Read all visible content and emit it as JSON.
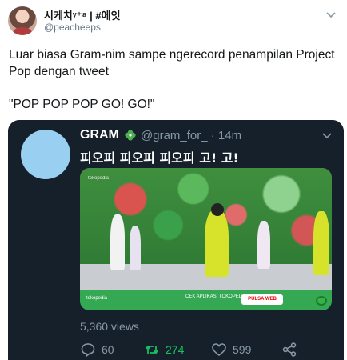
{
  "author": {
    "display_name": "시케치ʸ⁺⁸ | #에잇",
    "handle": "@peacheeps"
  },
  "tweet": {
    "text": "Luar biasa Gram-nim sampe ngerecord penampilan Project Pop dengan tweet",
    "quote": "\"POP POP POP GO! GO!\""
  },
  "embedded_tweet": {
    "display_name": "GRAM",
    "handle_time": "@gram_for_ · 14m",
    "text": "피오피 피오피 피오피 고! 고!",
    "views": "5,360 views",
    "media": {
      "corner_logo": "tokopedia",
      "banner_logo": "tokopedia",
      "banner_cta": "CEK APLIKASI TOKOPEDIA",
      "banner_pill": "PULSA WEB"
    },
    "actions": {
      "replies": "60",
      "retweets": "274",
      "likes": "599"
    }
  },
  "colors": {
    "embed_bg": "#16202b",
    "retweet_green": "#17bf63",
    "muted": "#8899a6",
    "clover_green": "#4caf50"
  },
  "icons": [
    "chevron-down-icon",
    "clover-icon",
    "reply-icon",
    "retweet-icon",
    "like-icon",
    "share-icon"
  ]
}
